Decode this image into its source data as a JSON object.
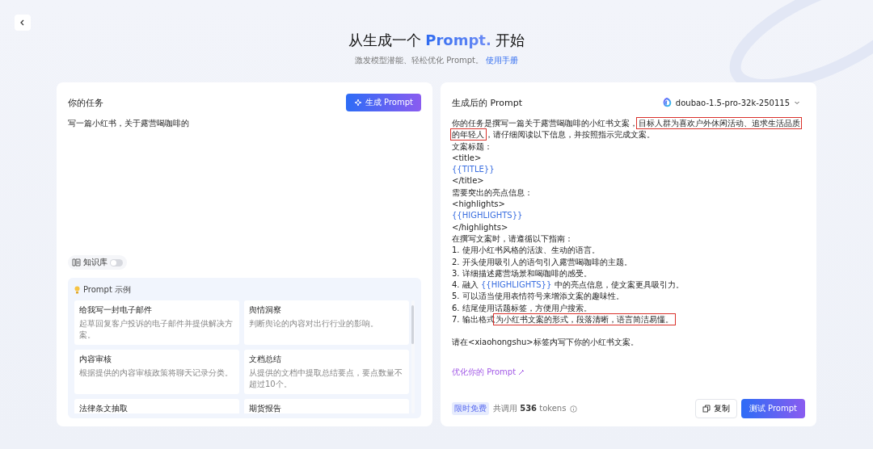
{
  "header": {
    "title_before": "从生成一个",
    "title_highlight": "Prompt.",
    "title_after": "开始",
    "subtitle": "激发模型潜能、轻松优化 Prompt。",
    "manual_link": "使用手册"
  },
  "task_panel": {
    "title": "你的任务",
    "generate_button": "生成 Prompt",
    "task_text": "写一篇小红书，关于露营喝咖啡的",
    "knowledge_base": {
      "label": "知识库",
      "on": false
    },
    "examples": {
      "title": "Prompt 示例",
      "items": [
        {
          "title": "给我写一封电子邮件",
          "description": "起草回复客户投诉的电子邮件并提供解决方案。"
        },
        {
          "title": "舆情洞察",
          "description": "判断舆论的内容对出行行业的影响。"
        },
        {
          "title": "内容审核",
          "description": "根据提供的内容审核政策将聊天记录分类。"
        },
        {
          "title": "文档总结",
          "description": "从提供的文档中提取总结要点，要点数量不超过10个。"
        },
        {
          "title": "法律条文抽取"
        },
        {
          "title": "期货报告"
        }
      ]
    }
  },
  "result_panel": {
    "title": "生成后的 Prompt",
    "model": "doubao-1.5-pro-32k-250115",
    "paragraphs": [
      [
        {
          "segments": [
            {
              "kind": "plain",
              "text": "你的任务是撰写一篇关于露营喝咖啡的小红书文案，"
            },
            {
              "kind": "marked",
              "text": "目标人群为喜欢户外休闲活动、追求生活品质的年轻人"
            },
            {
              "kind": "plain",
              "text": "，请仔细阅读以下信息，并按照指示完成文案。"
            }
          ]
        },
        {
          "segments": [
            {
              "kind": "plain",
              "text": "文案标题："
            }
          ]
        },
        {
          "segments": [
            {
              "kind": "plain",
              "text": "<title>"
            }
          ]
        },
        {
          "segments": [
            {
              "kind": "variable",
              "text": "{{TITLE}}"
            }
          ]
        },
        {
          "segments": [
            {
              "kind": "plain",
              "text": "</title>"
            }
          ]
        },
        {
          "segments": [
            {
              "kind": "plain",
              "text": "需要突出的亮点信息："
            }
          ]
        },
        {
          "segments": [
            {
              "kind": "plain",
              "text": "<highlights>"
            }
          ]
        },
        {
          "segments": [
            {
              "kind": "variable",
              "text": "{{HIGHLIGHTS}}"
            }
          ]
        },
        {
          "segments": [
            {
              "kind": "plain",
              "text": "</highlights>"
            }
          ]
        },
        {
          "segments": [
            {
              "kind": "plain",
              "text": "在撰写文案时，请遵循以下指南："
            }
          ]
        },
        {
          "segments": [
            {
              "kind": "plain",
              "text": "1. 使用小红书风格的活泼、生动的语言。"
            }
          ]
        },
        {
          "segments": [
            {
              "kind": "plain",
              "text": "2. 开头使用吸引人的语句引入露营喝咖啡的主题。"
            }
          ]
        },
        {
          "segments": [
            {
              "kind": "plain",
              "text": "3. 详细描述露营场景和喝咖啡的感受。"
            }
          ]
        },
        {
          "segments": [
            {
              "kind": "plain",
              "text": "4. 融入 "
            },
            {
              "kind": "variable",
              "text": "{{HIGHLIGHTS}}"
            },
            {
              "kind": "plain",
              "text": " 中的亮点信息，使文案更具吸引力。"
            }
          ]
        },
        {
          "segments": [
            {
              "kind": "plain",
              "text": "5. 可以适当使用表情符号来增添文案的趣味性。"
            }
          ]
        },
        {
          "segments": [
            {
              "kind": "plain",
              "text": "6. 结尾使用话题标签，方便用户搜索。"
            }
          ]
        },
        {
          "segments": [
            {
              "kind": "plain",
              "text": "7. 输出格式"
            },
            {
              "kind": "marked",
              "text": "为小红书文案的形式，段落清晰，语言简洁易懂。"
            }
          ]
        }
      ],
      [
        {
          "segments": [
            {
              "kind": "plain",
              "text": "请在<xiaohongshu>标签内写下你的小红书文案。"
            }
          ]
        }
      ]
    ],
    "optimize_link": "优化你的 Prompt",
    "free_badge": "限时免费",
    "usage_label": "共调用",
    "token_count": "536",
    "token_unit": "tokens",
    "copy_button": "复制",
    "test_button": "测试 Prompt"
  }
}
